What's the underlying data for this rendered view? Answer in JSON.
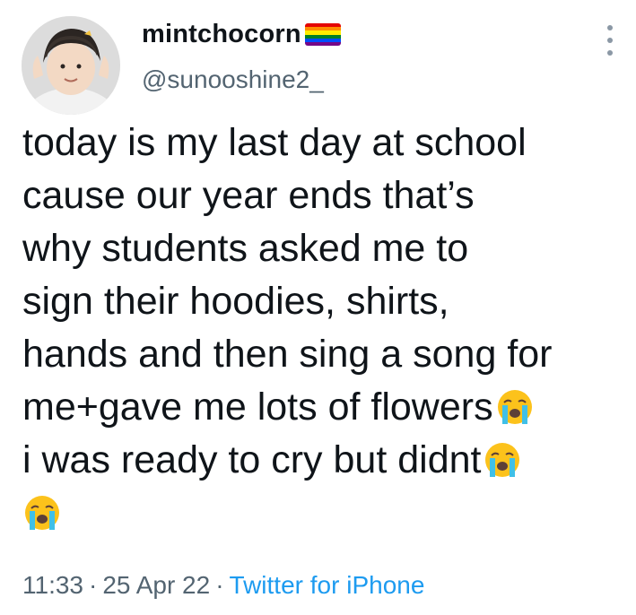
{
  "author": {
    "display_name": "mintchocorn",
    "badge_icon": "rainbow-flag-icon",
    "handle": "@sunooshine2_"
  },
  "tweet": {
    "lines": [
      "today is my last day at school",
      "cause our year ends that’s",
      "why students asked me to",
      "sign their hoodies, shirts,",
      "hands and then sing a song for",
      "me+gave me lots of flowers",
      "i was ready to cry but didnt",
      ""
    ],
    "emoji_name": "loudly-crying-face-icon"
  },
  "meta": {
    "time": "11:33",
    "date": "25 Apr 22",
    "separator": "·",
    "source": "Twitter for iPhone"
  },
  "colors": {
    "text": "#0f1419",
    "secondary": "#536471",
    "link": "#1d9bf0"
  }
}
